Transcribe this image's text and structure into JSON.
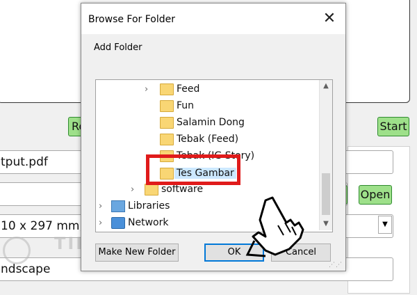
{
  "background": {
    "button_partial_left": "Re",
    "button_start": "Start",
    "field_output": "tput.pdf",
    "button_open": "Open",
    "field_paper_size": "10 x 297 mm,",
    "field_orientation": "ndscape",
    "watermark_text": "TIPS PINTAR",
    "accent_green": "#9ee08a"
  },
  "dialog": {
    "title": "Browse For Folder",
    "close_label": "✕",
    "description": "Add Folder",
    "tree": [
      {
        "label": "Feed",
        "expandable": true
      },
      {
        "label": "Fun",
        "expandable": false
      },
      {
        "label": "Salamin Dong",
        "expandable": false
      },
      {
        "label": "Tebak (Feed)",
        "expandable": false
      },
      {
        "label": "Tebak (IG Story)",
        "expandable": false
      },
      {
        "label": "Tes Gambar",
        "expandable": false,
        "selected": true
      },
      {
        "label": "software",
        "expandable": true
      },
      {
        "label": "Libraries",
        "expandable": true
      },
      {
        "label": "Network",
        "expandable": true
      }
    ],
    "buttons": {
      "make_new_folder": "Make New Folder",
      "ok": "OK",
      "cancel": "Cancel"
    },
    "highlight_color": "#e01b1b",
    "selection_color": "#cce8ff"
  }
}
